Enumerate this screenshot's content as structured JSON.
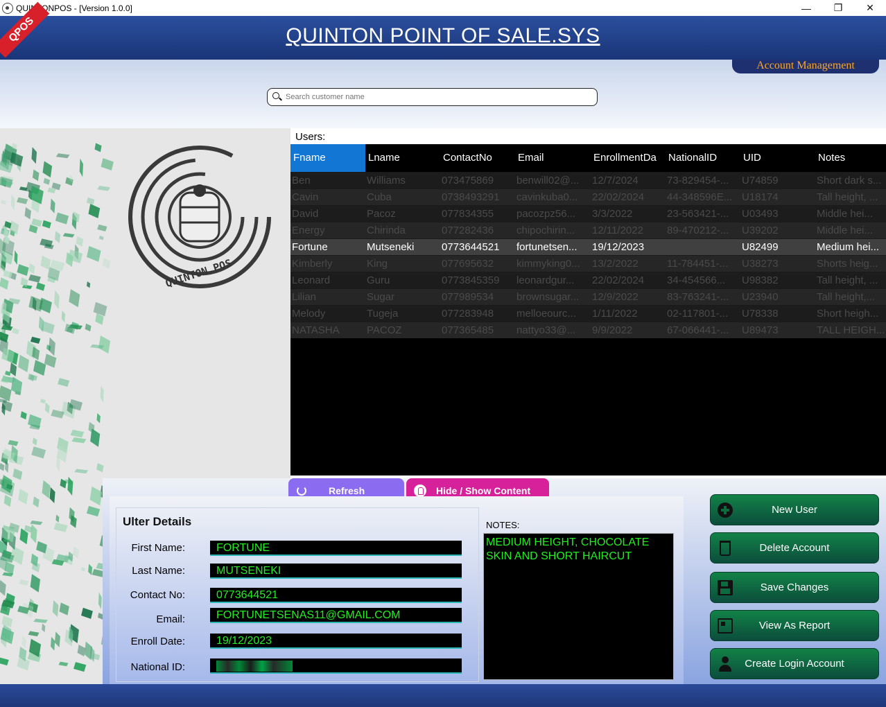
{
  "window": {
    "title": "QUINTONPOS - [Version 1.0.0]",
    "minimize": "—",
    "maximize": "❐",
    "close": "✕"
  },
  "banner": {
    "ribbon": "QPOS",
    "title": "QUINTON POINT OF SALE.SYS",
    "account_tab": "Account Management"
  },
  "search": {
    "placeholder": "Search customer name"
  },
  "logo": {
    "text": "QUINTON.POS"
  },
  "users": {
    "label": "Users:",
    "columns": [
      "Fname",
      "Lname",
      "ContactNo",
      "Email",
      "EnrollmentDa",
      "NationalID",
      "UID",
      "Notes"
    ],
    "rows": [
      [
        "Ben",
        "Williams",
        "073475869",
        "benwill02@...",
        "12/7/2024",
        "73-829454-...",
        "U74859",
        "Short dark s..."
      ],
      [
        "Cavin",
        "Cuba",
        "0738493291",
        "cavinkuba0...",
        "22/02/2024",
        "44-348596E...",
        "U18174",
        "Tall height, ..."
      ],
      [
        "David",
        "Pacoz",
        "077834355",
        "pacozpz56...",
        "3/3/2022",
        "23-563421-...",
        "U03493",
        "Middle hei..."
      ],
      [
        "Energy",
        "Chirinda",
        "077282436",
        "chipochirin...",
        "12/11/2022",
        "89-470212-...",
        "U39202",
        "Middle hei..."
      ],
      [
        "Fortune",
        "Mutseneki",
        "0773644521",
        "fortunetsen...",
        "19/12/2023",
        "",
        "U82499",
        "Medium hei..."
      ],
      [
        "Kimberly",
        "King",
        "077695632",
        "kimmyking0...",
        "13/2/2022",
        "11-784451-...",
        "U38273",
        "Shorts heig..."
      ],
      [
        "Leonard",
        "Guru",
        "0773845359",
        "leonardgur...",
        "22/02/2024",
        "34-454566...",
        "U98382",
        "Tall height, ..."
      ],
      [
        "Lilian",
        "Sugar",
        "077989534",
        "brownsugar...",
        "12/9/2022",
        "83-763241-...",
        "U23940",
        "Tall height,..."
      ],
      [
        "Melody",
        "Tugeja",
        "077283948",
        "melloeourc...",
        "1/11/2022",
        "02-117801-...",
        "U78338",
        "Short heigh..."
      ],
      [
        "NATASHA",
        "PACOZ",
        "077365485",
        "nattyo33@...",
        "9/9/2022",
        "67-066441-...",
        "U89473",
        "TALL HEIGH..."
      ]
    ],
    "selected_row": 4
  },
  "buttons": {
    "refresh": "Refresh",
    "hide_show": "Hide / Show Content",
    "new_user": "New User",
    "delete_account": "Delete Account",
    "save_changes": "Save Changes",
    "view_report": "View As Report",
    "create_login": "Create Login Account"
  },
  "details": {
    "title": "Ulter Details",
    "labels": {
      "first_name": "First Name:",
      "last_name": "Last Name:",
      "contact": "Contact No:",
      "email": "Email:",
      "enroll": "Enroll Date:",
      "national_id": "National ID:"
    },
    "values": {
      "first_name": "FORTUNE",
      "last_name": "MUTSENEKI",
      "contact": "0773644521",
      "email": "FORTUNETSENAS11@GMAIL.COM",
      "enroll": "19/12/2023",
      "national_id": ""
    },
    "notes_label": "NOTES:",
    "notes": "MEDIUM HEIGHT, CHOCOLATE SKIN AND SHORT HAIRCUT"
  },
  "colors": {
    "banner": "#1a3578",
    "grid_header_active": "#1277d4",
    "refresh": "#8b6cf0",
    "hide_show": "#d6219b",
    "side_buttons": "#0e6a3f",
    "field_text": "#22ee22",
    "account_tab_text": "#ffa722"
  }
}
